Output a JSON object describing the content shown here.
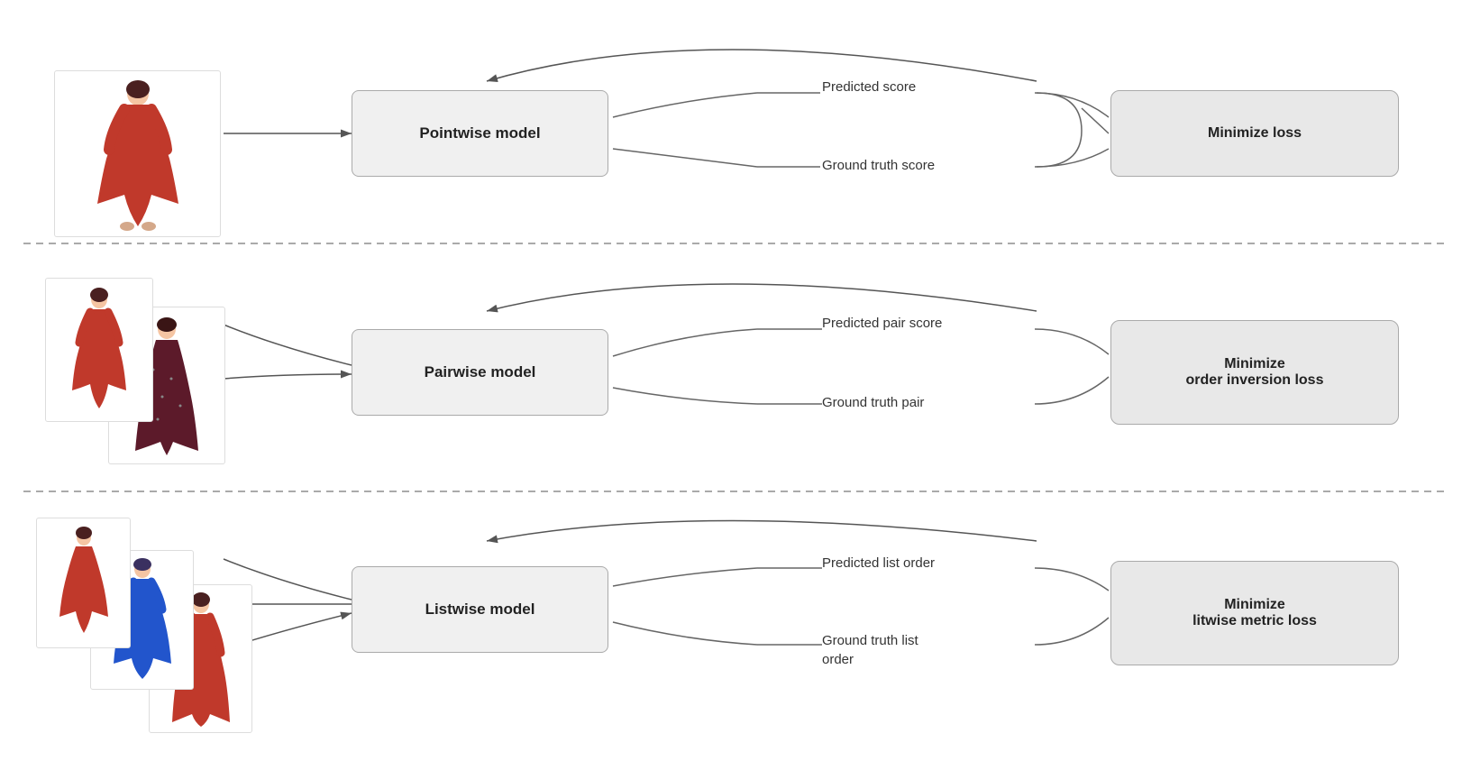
{
  "rows": [
    {
      "id": "pointwise",
      "model_label": "Pointwise model",
      "loss_label": "Minimize loss",
      "output_top": "Predicted score",
      "output_bottom": "Ground truth score"
    },
    {
      "id": "pairwise",
      "model_label": "Pairwise model",
      "loss_label": "Minimize\norder inversion loss",
      "output_top": "Predicted pair score",
      "output_bottom": "Ground truth pair"
    },
    {
      "id": "listwise",
      "model_label": "Listwise model",
      "loss_label": "Minimize\nlitwise metric loss",
      "output_top": "Predicted list order",
      "output_bottom": "Ground truth list\norder"
    }
  ]
}
